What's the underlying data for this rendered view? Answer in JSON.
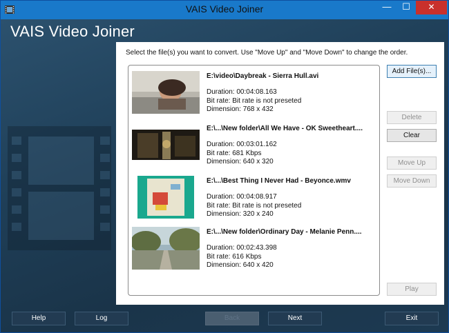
{
  "window": {
    "title": "VAIS Video Joiner",
    "controls": {
      "minimize": "—",
      "maximize": "☐",
      "close": "✕"
    }
  },
  "heading": "VAIS Video Joiner",
  "instruction": "Select the file(s) you want to convert. Use \"Move Up\" and \"Move Down\" to change the order.",
  "files": [
    {
      "name": "E:\\video\\Daybreak - Sierra Hull.avi",
      "duration": "Duration: 00:04:08.163",
      "bitrate": "Bit rate: Bit rate is not preseted",
      "dimension": "Dimension: 768 x 432"
    },
    {
      "name": "E:\\...\\New folder\\All We Have - OK Sweetheart....",
      "duration": "Duration: 00:03:01.162",
      "bitrate": "Bit rate: 681 Kbps",
      "dimension": "Dimension: 640 x 320"
    },
    {
      "name": "E:\\...\\Best Thing I Never Had - Beyonce.wmv",
      "duration": "Duration: 00:04:08.917",
      "bitrate": "Bit rate: Bit rate is not preseted",
      "dimension": "Dimension: 320 x 240"
    },
    {
      "name": "E:\\...\\New folder\\Ordinary Day - Melanie Penn....",
      "duration": "Duration: 00:02:43.398",
      "bitrate": "Bit rate: 616 Kbps",
      "dimension": "Dimension: 640 x 420"
    }
  ],
  "side_buttons": {
    "add_files": "Add File(s)...",
    "delete": "Delete",
    "clear": "Clear",
    "move_up": "Move Up",
    "move_down": "Move Down",
    "play": "Play"
  },
  "bottom_buttons": {
    "help": "Help",
    "log": "Log",
    "back": "Back",
    "next": "Next",
    "exit": "Exit"
  },
  "colors": {
    "titlebar": "#1979ca",
    "close_button": "#c9302c",
    "background": "#1f3f58",
    "panel": "#ffffff"
  }
}
